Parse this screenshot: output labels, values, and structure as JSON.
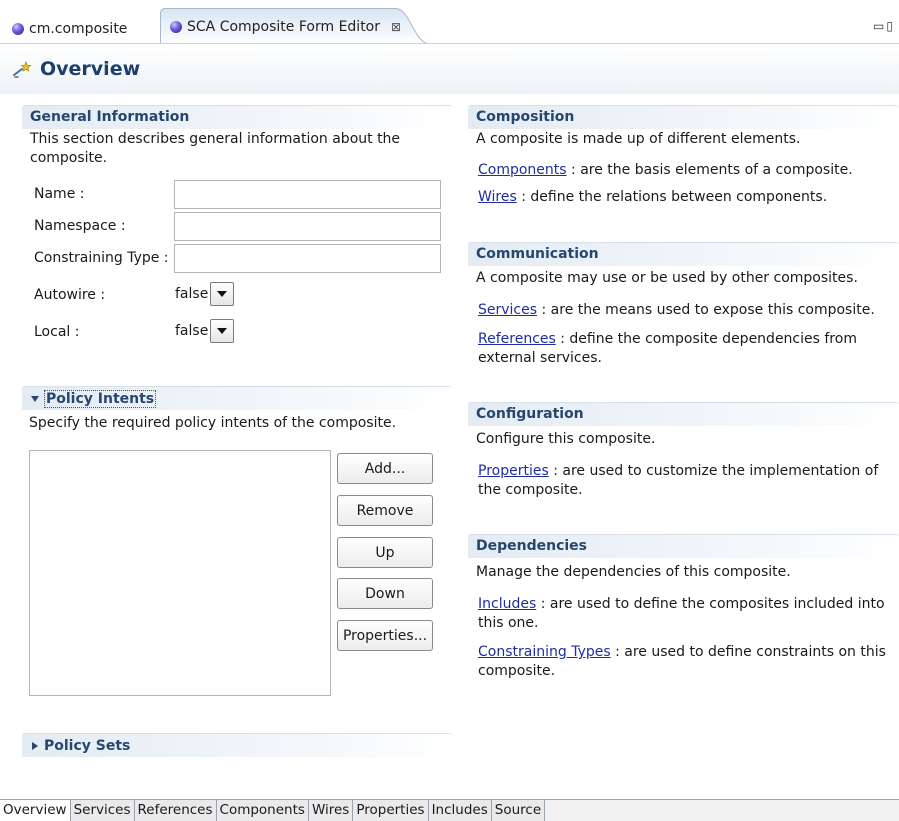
{
  "editor_tabs": [
    {
      "label": "cm.composite"
    },
    {
      "label": "SCA Composite Form Editor"
    }
  ],
  "form": {
    "title": "Overview"
  },
  "general": {
    "title": "General Information",
    "description": "This section describes general information about the composite.",
    "fields": {
      "name": {
        "label": "Name :",
        "value": ""
      },
      "namespace": {
        "label": "Namespace :",
        "value": ""
      },
      "constraining_type": {
        "label": "Constraining Type :",
        "value": ""
      },
      "autowire": {
        "label": "Autowire :",
        "value": "false"
      },
      "local": {
        "label": "Local :",
        "value": "false"
      }
    }
  },
  "policy_intents": {
    "title": "Policy Intents",
    "description": "Specify the required policy intents of the composite.",
    "buttons": {
      "add": "Add...",
      "remove": "Remove",
      "up": "Up",
      "down": "Down",
      "properties": "Properties..."
    }
  },
  "policy_sets": {
    "title": "Policy Sets"
  },
  "composition": {
    "title": "Composition",
    "description": "A composite is made up of different elements.",
    "components_link": "Components",
    "components_text": " : are the basis elements of a composite.",
    "wires_link": "Wires",
    "wires_text": " : define the relations between components."
  },
  "communication": {
    "title": "Communication",
    "description": "A composite may use or be used by other composites.",
    "services_link": "Services",
    "services_text": " : are the means used to expose this composite.",
    "references_link": "References",
    "references_text": " : define the composite dependencies from external services."
  },
  "configuration": {
    "title": "Configuration",
    "description": "Configure this composite.",
    "properties_link": "Properties",
    "properties_text": " : are used to customize the implementation of the composite."
  },
  "dependencies": {
    "title": "Dependencies",
    "description": "Manage the dependencies of this composite.",
    "includes_link": "Includes",
    "includes_text": " : are used to define the composites included into this one.",
    "constraining_link": "Constraining Types",
    "constraining_text": " : are used to define constraints on this composite."
  },
  "page_tabs": [
    "Overview",
    "Services",
    "References",
    "Components",
    "Wires",
    "Properties",
    "Includes",
    "Source"
  ],
  "colors": {
    "section_title": "#25476f",
    "link": "#1d2ea3",
    "header_title": "#1c3f6e"
  }
}
